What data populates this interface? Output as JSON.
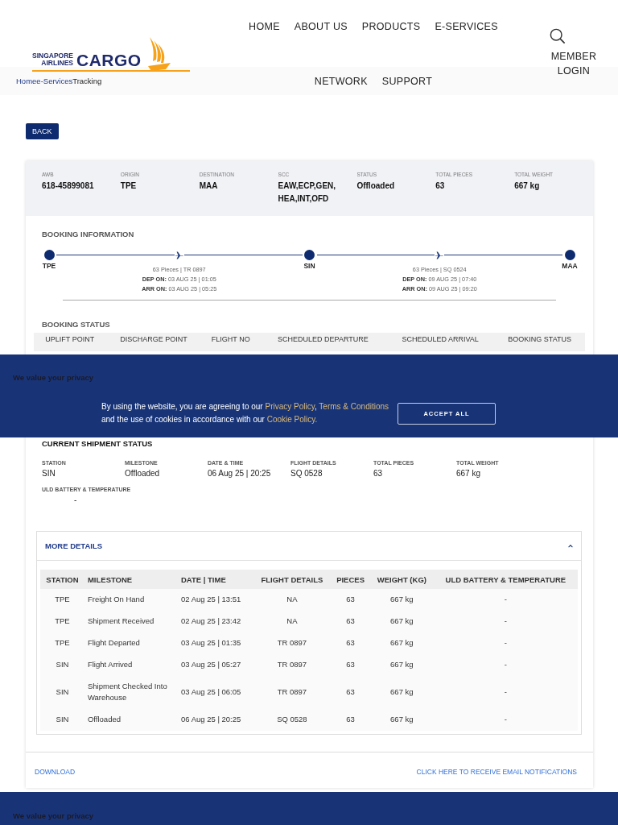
{
  "header": {
    "logo": {
      "line1": "SINGAPORE",
      "line2": "AIRLINES",
      "word": "CARGO"
    },
    "nav_top": [
      "HOME",
      "ABOUT US",
      "PRODUCTS",
      "E-SERVICES"
    ],
    "nav_bottom": [
      "NETWORK",
      "SUPPORT"
    ],
    "member_login": "MEMBER LOGIN",
    "breadcrumb": [
      {
        "label": "Home",
        "link": true
      },
      {
        "label": "e-Services",
        "link": true
      },
      {
        "label": "Tracking",
        "link": false
      }
    ]
  },
  "back_button": "BACK",
  "summary": [
    {
      "label": "AWB",
      "value": "618-45899081"
    },
    {
      "label": "ORIGIN",
      "value": "TPE"
    },
    {
      "label": "DESTINATION",
      "value": "MAA"
    },
    {
      "label": "SCC",
      "value": "EAW,ECP,GEN, HEA,INT,OFD"
    },
    {
      "label": "STATUS",
      "value": "Offloaded"
    },
    {
      "label": "TOTAL PIECES",
      "value": "63"
    },
    {
      "label": "TOTAL WEIGHT",
      "value": "667 kg"
    }
  ],
  "booking_information": {
    "title": "BOOKING INFORMATION",
    "stations": [
      "TPE",
      "SIN",
      "MAA"
    ],
    "legs": [
      {
        "pieces": "63 Pieces | TR 0897",
        "dep_label": "DEP ON:",
        "dep": "03 AUG 25 | 01:05",
        "arr_label": "ARR ON:",
        "arr": "03 AUG 25 | 05:25"
      },
      {
        "pieces": "63 Pieces | SQ 0524",
        "dep_label": "DEP ON:",
        "dep": "09 AUG 25 | 07:40",
        "arr_label": "ARR ON:",
        "arr": "09 AUG 25 | 09:20"
      }
    ]
  },
  "booking_status": {
    "title": "BOOKING STATUS",
    "columns": [
      "UPLIFT POINT",
      "DISCHARGE POINT",
      "FLIGHT NO",
      "SCHEDULED DEPARTURE",
      "SCHEDULED ARRIVAL",
      "BOOKING STATUS"
    ]
  },
  "current_status": {
    "title": "CURRENT SHIPMENT STATUS",
    "fields": [
      {
        "label": "STATION",
        "value": "SIN"
      },
      {
        "label": "MILESTONE",
        "value": "Offloaded"
      },
      {
        "label": "DATE & TIME",
        "value": "06 Aug 25 | 20:25"
      },
      {
        "label": "FLIGHT DETAILS",
        "value": "SQ 0528"
      },
      {
        "label": "TOTAL PIECES",
        "value": "63"
      },
      {
        "label": "TOTAL WEIGHT",
        "value": "667 kg"
      }
    ],
    "uld": {
      "label": "ULD BATTERY & TEMPERATURE",
      "value": "-"
    }
  },
  "more_details": {
    "title": "MORE DETAILS",
    "expanded": true,
    "columns": [
      "STATION",
      "MILESTONE",
      "DATE | TIME",
      "FLIGHT DETAILS",
      "PIECES",
      "WEIGHT (KG)",
      "ULD BATTERY & TEMPERATURE"
    ],
    "rows": [
      [
        "TPE",
        "Freight On Hand",
        "02 Aug 25 | 13:51",
        "NA",
        "63",
        "667 kg",
        "-"
      ],
      [
        "TPE",
        "Shipment Received",
        "02 Aug 25 | 23:42",
        "NA",
        "63",
        "667 kg",
        "-"
      ],
      [
        "TPE",
        "Flight Departed",
        "03 Aug 25 | 01:35",
        "TR 0897",
        "63",
        "667 kg",
        "-"
      ],
      [
        "SIN",
        "Flight Arrived",
        "03 Aug 25 | 05:27",
        "TR 0897",
        "63",
        "667 kg",
        "-"
      ],
      [
        "SIN",
        "Shipment Checked Into Warehouse",
        "03 Aug 25 | 06:05",
        "TR 0897",
        "63",
        "667 kg",
        "-"
      ],
      [
        "SIN",
        "Offloaded",
        "06 Aug 25 | 20:25",
        "SQ 0528",
        "63",
        "667 kg",
        "-"
      ]
    ]
  },
  "footer_links": {
    "download": "DOWNLOAD",
    "notify": "CLICK HERE TO RECEIVE EMAIL NOTIFICATIONS"
  },
  "cookie_banner": {
    "title": "We value your privacy",
    "text_before": "By using the website, you are agreeing to our",
    "privacy": "Privacy Policy",
    "sep": ",",
    "terms": "Terms & Conditions",
    "text_middle": "and the use of cookies in accordance with our",
    "cookie": "Cookie Policy.",
    "button": "ACCEPT ALL"
  },
  "bottom_banner": {
    "title": "We value your privacy"
  }
}
